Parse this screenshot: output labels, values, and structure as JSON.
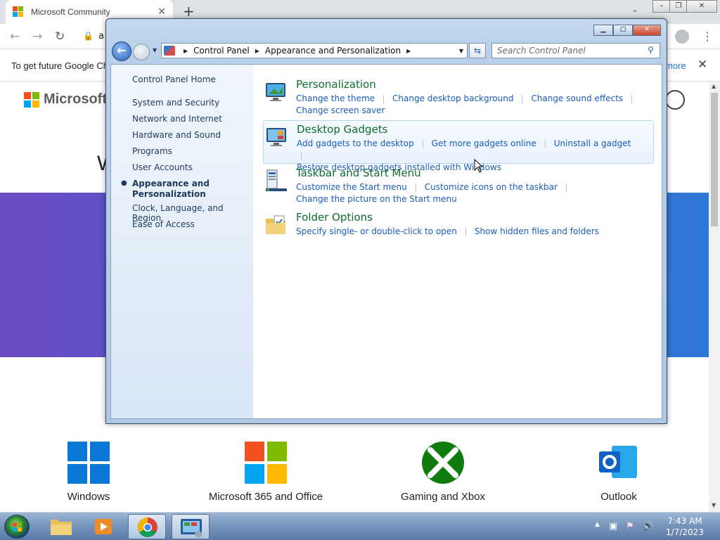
{
  "browser": {
    "tab_title": "Microsoft Community",
    "new_tab": "+",
    "url_fragment": "a",
    "infobar_message": "To get future Google Ch",
    "infobar_more": "more",
    "page_logo_text": "Microsoft",
    "page_heading_fragment": "W",
    "products": [
      {
        "label": "Windows"
      },
      {
        "label": "Microsoft 365 and Office"
      },
      {
        "label": "Gaming and Xbox"
      },
      {
        "label": "Outlook"
      }
    ]
  },
  "window": {
    "breadcrumb": [
      "Control Panel",
      "Appearance and Personalization"
    ],
    "search_placeholder": "Search Control Panel"
  },
  "left_nav": {
    "home": "Control Panel Home",
    "items": [
      {
        "label": "System and Security"
      },
      {
        "label": "Network and Internet"
      },
      {
        "label": "Hardware and Sound"
      },
      {
        "label": "Programs"
      },
      {
        "label": "User Accounts"
      },
      {
        "label": "Appearance and Personalization",
        "line1": "Appearance and",
        "line2": "Personalization",
        "active": true
      },
      {
        "label": "Clock, Language, and Region"
      },
      {
        "label": "Ease of Access"
      }
    ]
  },
  "categories": [
    {
      "title": "Personalization",
      "tasks": [
        "Change the theme",
        "Change desktop background",
        "Change sound effects",
        "Change screen saver"
      ]
    },
    {
      "title": "Desktop Gadgets",
      "tasks": [
        "Add gadgets to the desktop",
        "Get more gadgets online",
        "Uninstall a gadget",
        "Restore desktop gadgets installed with Windows"
      ]
    },
    {
      "title": "Taskbar and Start Menu",
      "tasks": [
        "Customize the Start menu",
        "Customize icons on the taskbar",
        "Change the picture on the Start menu"
      ]
    },
    {
      "title": "Folder Options",
      "tasks": [
        "Specify single- or double-click to open",
        "Show hidden files and folders"
      ]
    }
  ],
  "taskbar": {
    "time": "7:43 AM",
    "date": "1/7/2023"
  },
  "colors": {
    "category_title": "#0d6e2e",
    "task_link": "#1a5cb8",
    "nav_text": "#1e395b"
  }
}
